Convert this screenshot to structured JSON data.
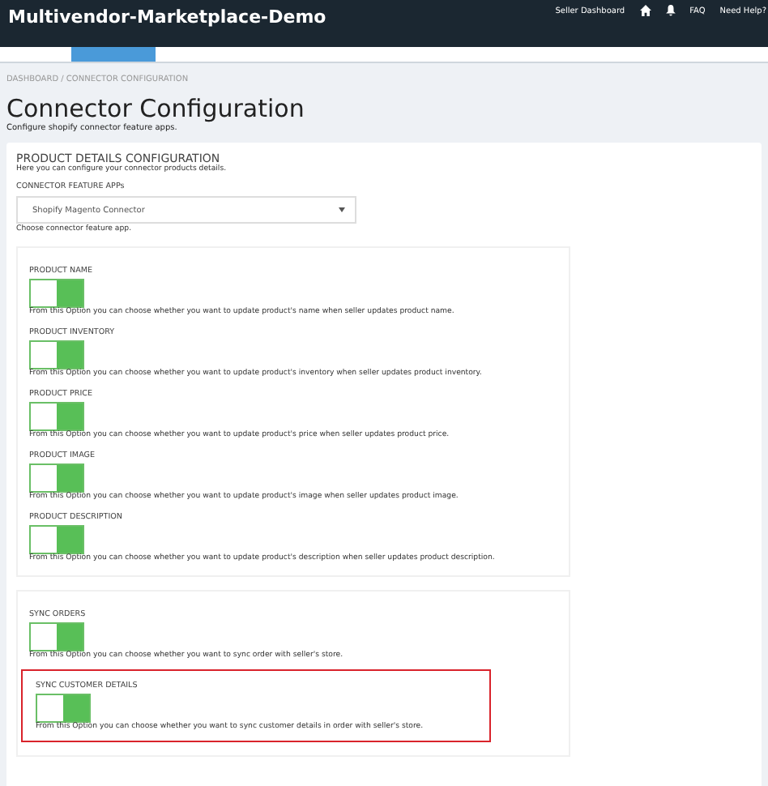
{
  "header": {
    "brand": "Multivendor-Marketplace-Demo",
    "links": [
      {
        "kind": "text",
        "label": "Seller Dashboard"
      },
      {
        "kind": "home"
      },
      {
        "kind": "bell"
      },
      {
        "kind": "text",
        "label": "FAQ"
      },
      {
        "kind": "text",
        "label": "Need Help?"
      }
    ]
  },
  "breadcrumb": "DASHBOARD / CONNECTOR CONFIGURATION",
  "title": "Connector Configuration",
  "subtitle": "Configure shopify connector feature apps.",
  "panel": {
    "heading": "PRODUCT DETAILS CONFIGURATION",
    "intro": "Here you can configure your connector products details.",
    "select_label": "CONNECTOR FEATURE APPs",
    "select_value": "Shopify Magento Connector",
    "select_help": "Choose connector feature app.",
    "groups": [
      {
        "options": [
          {
            "label": "PRODUCT NAME",
            "on": true,
            "highlighted": false,
            "description": "From this Option you can choose whether you want to update product's name when seller updates product name."
          },
          {
            "label": "PRODUCT INVENTORY",
            "on": true,
            "highlighted": false,
            "description": "From this Option you can choose whether you want to update product's inventory when seller updates product inventory."
          },
          {
            "label": "PRODUCT PRICE",
            "on": true,
            "highlighted": false,
            "description": "From this Option you can choose whether you want to update product's price when seller updates product price."
          },
          {
            "label": "PRODUCT IMAGE",
            "on": true,
            "highlighted": false,
            "description": "From this Option you can choose whether you want to update product's image when seller updates product image."
          },
          {
            "label": "PRODUCT DESCRIPTION",
            "on": true,
            "highlighted": false,
            "description": "From this Option you can choose whether you want to update product's description when seller updates product description."
          }
        ]
      },
      {
        "options": [
          {
            "label": "SYNC ORDERS",
            "on": true,
            "highlighted": false,
            "description": "From this Option you can choose whether you want to sync order with seller's store."
          },
          {
            "label": "SYNC CUSTOMER DETAILS",
            "on": true,
            "highlighted": true,
            "description": "From this Option you can choose whether you want to sync customer details in order with seller's store."
          }
        ]
      }
    ]
  }
}
